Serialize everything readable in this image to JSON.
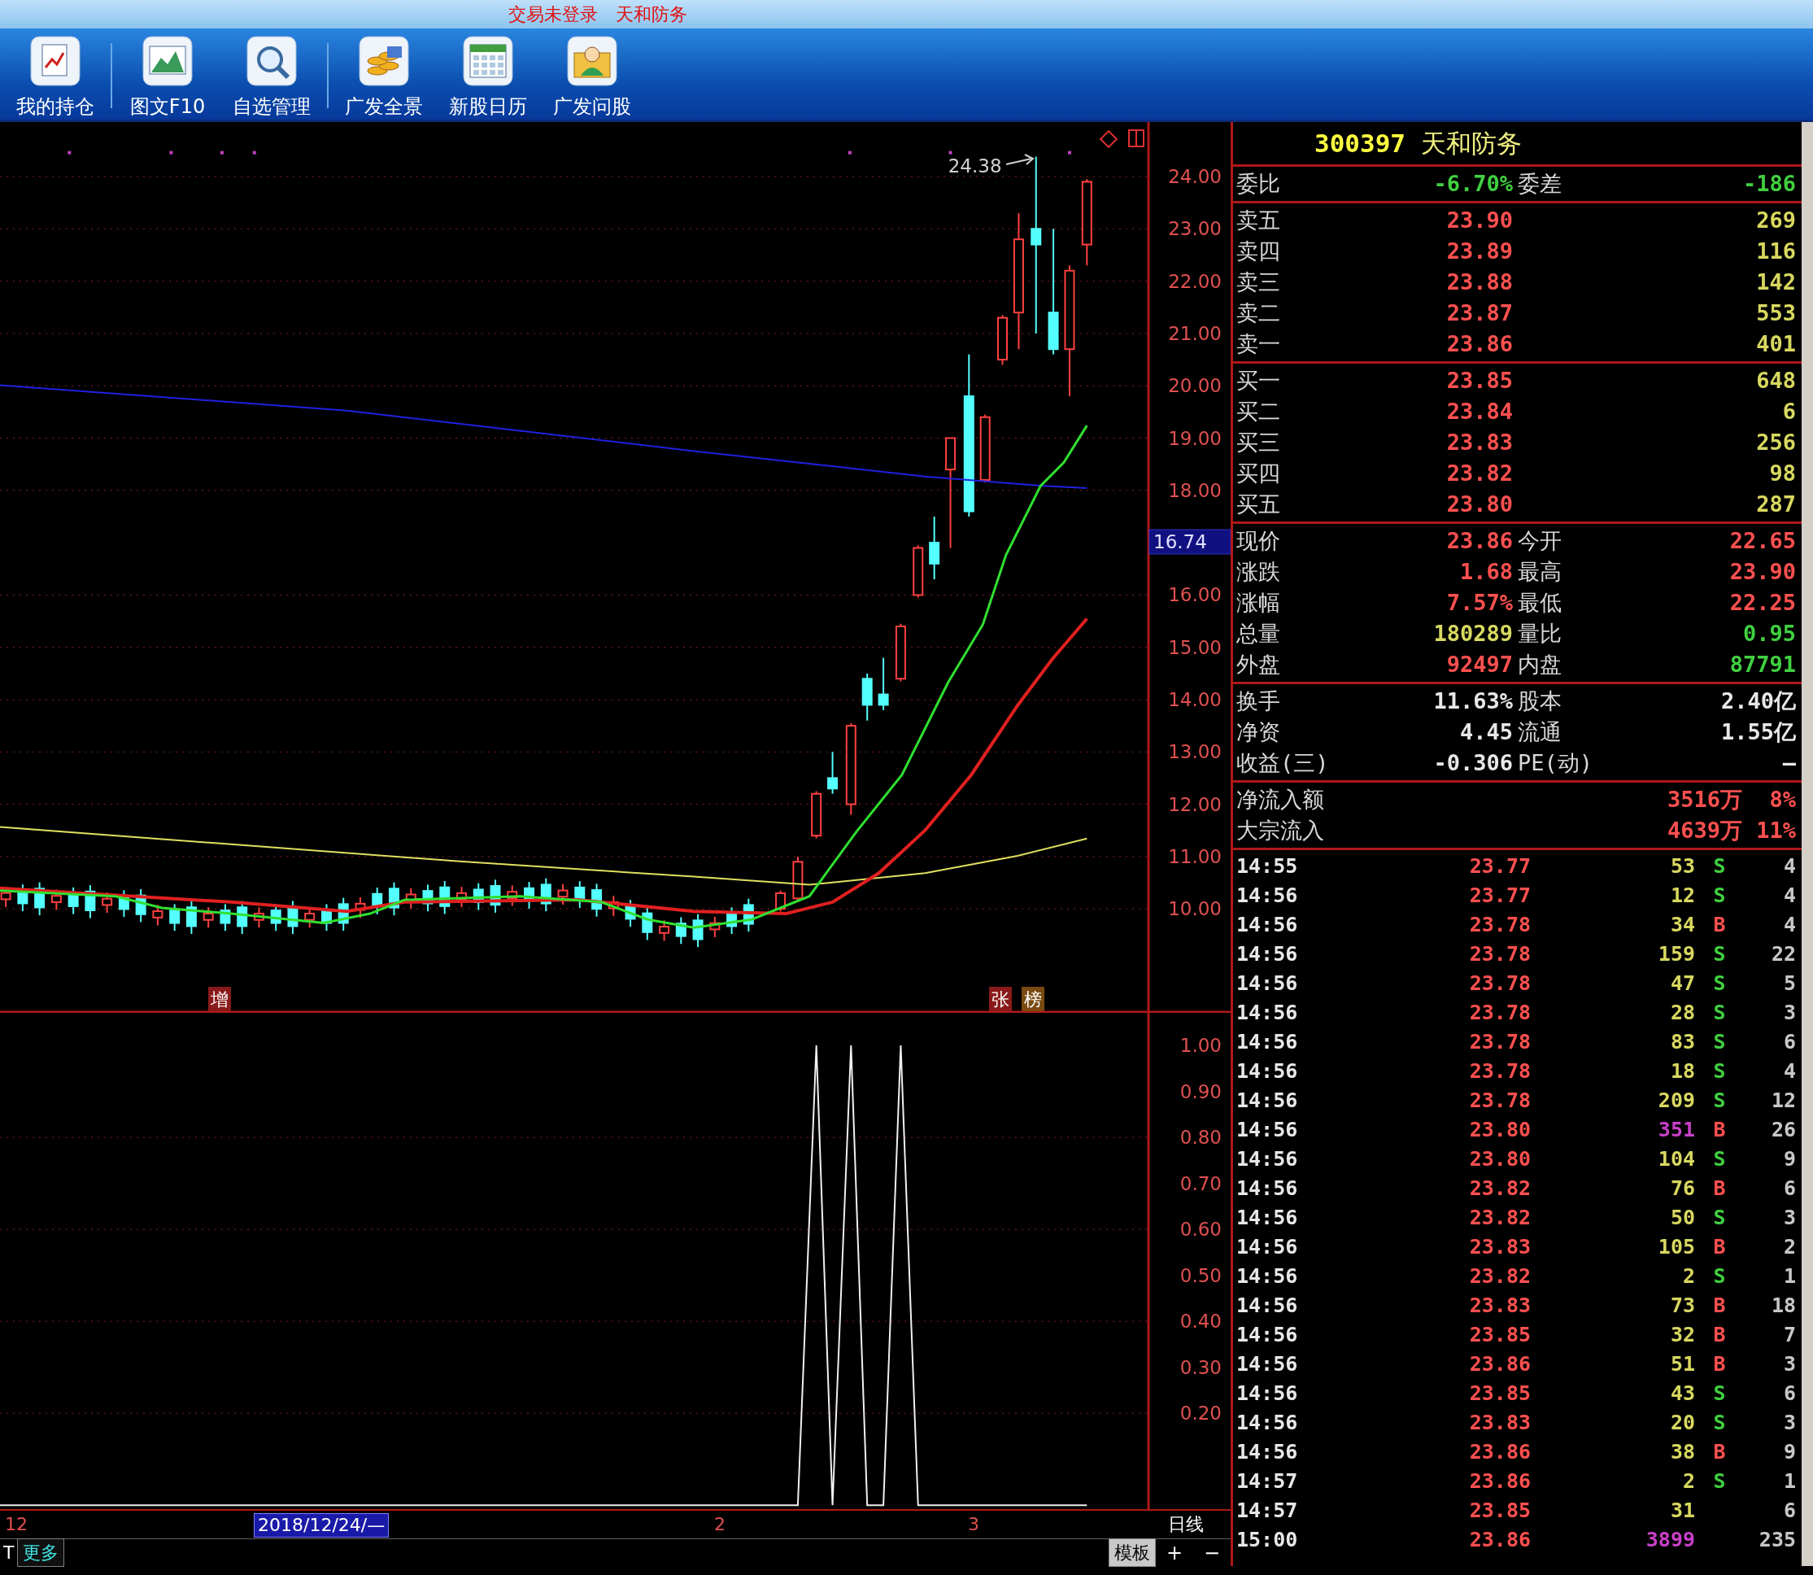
{
  "window": {
    "title": "交易未登录　天和防务"
  },
  "toolbar": [
    {
      "label": "我的持仓",
      "separator_after": true
    },
    {
      "label": "图文F10",
      "separator_after": false
    },
    {
      "label": "自选管理",
      "separator_after": true
    },
    {
      "label": "广发全景",
      "separator_after": false
    },
    {
      "label": "新股日历",
      "separator_after": false
    },
    {
      "label": "广发问股",
      "separator_after": false
    }
  ],
  "chart": {
    "price_axis": [
      "24.00",
      "23.00",
      "22.00",
      "21.00",
      "20.00",
      "19.00",
      "18.00",
      "16.00",
      "15.00",
      "14.00",
      "13.00",
      "12.00",
      "11.00",
      "10.00"
    ],
    "current_marker": "16.74",
    "high_annotation": "24.38",
    "badges": [
      "增",
      "张",
      "榜"
    ],
    "indicator_axis": [
      "1.00",
      "0.90",
      "0.80",
      "0.70",
      "0.60",
      "0.50",
      "0.40",
      "0.30",
      "0.20"
    ]
  },
  "date_bar": {
    "labels": [
      {
        "text": "12",
        "selected": false
      },
      {
        "text": "2018/12/24/—",
        "selected": true
      },
      {
        "text": "2",
        "selected": false
      },
      {
        "text": "3",
        "selected": false
      }
    ],
    "period": "日线"
  },
  "bottom_bar": {
    "left": "T",
    "more": "更多",
    "template": "模板",
    "plus": "+",
    "minus": "−"
  },
  "quote": {
    "code": "300397",
    "name": "天和防务",
    "ratio": {
      "left": {
        "label": "委比",
        "value": "-6.70%",
        "color": "#40d040"
      },
      "right": {
        "label": "委差",
        "value": "-186",
        "color": "#40d040"
      }
    },
    "sell": [
      {
        "label": "卖五",
        "price": "23.90",
        "volume": "269"
      },
      {
        "label": "卖四",
        "price": "23.89",
        "volume": "116"
      },
      {
        "label": "卖三",
        "price": "23.88",
        "volume": "142"
      },
      {
        "label": "卖二",
        "price": "23.87",
        "volume": "553"
      },
      {
        "label": "卖一",
        "price": "23.86",
        "volume": "401"
      }
    ],
    "buy": [
      {
        "label": "买一",
        "price": "23.85",
        "volume": "648"
      },
      {
        "label": "买二",
        "price": "23.84",
        "volume": "6"
      },
      {
        "label": "买三",
        "price": "23.83",
        "volume": "256"
      },
      {
        "label": "买四",
        "price": "23.82",
        "volume": "98"
      },
      {
        "label": "买五",
        "price": "23.80",
        "volume": "287"
      }
    ],
    "stats": [
      {
        "left": {
          "label": "现价",
          "value": "23.86",
          "color": "#ff5050"
        },
        "right": {
          "label": "今开",
          "value": "22.65",
          "color": "#ff5050"
        }
      },
      {
        "left": {
          "label": "涨跌",
          "value": "1.68",
          "color": "#ff5050"
        },
        "right": {
          "label": "最高",
          "value": "23.90",
          "color": "#ff5050"
        }
      },
      {
        "left": {
          "label": "涨幅",
          "value": "7.57%",
          "color": "#ff5050"
        },
        "right": {
          "label": "最低",
          "value": "22.25",
          "color": "#ff5050"
        }
      },
      {
        "left": {
          "label": "总量",
          "value": "180289",
          "color": "#d8d860"
        },
        "right": {
          "label": "量比",
          "value": "0.95",
          "color": "#40d040"
        }
      },
      {
        "left": {
          "label": "外盘",
          "value": "92497",
          "color": "#ff5050"
        },
        "right": {
          "label": "内盘",
          "value": "87791",
          "color": "#40d040"
        }
      }
    ],
    "fundamentals": [
      {
        "label": "换手",
        "value": "11.63%",
        "label2": "股本",
        "value2": "2.40亿"
      },
      {
        "label": "净资",
        "value": "4.45",
        "label2": "流通",
        "value2": "1.55亿"
      },
      {
        "label": "收益(三)",
        "value": "-0.306",
        "label2": "PE(动)",
        "value2": "—"
      }
    ],
    "flows": [
      {
        "label": "净流入额",
        "amount": "3516万",
        "percent": "8%"
      },
      {
        "label": "大宗流入",
        "amount": "4639万",
        "percent": "11%"
      }
    ]
  },
  "ticks": [
    {
      "time": "14:55",
      "price": "23.77",
      "volume": "53",
      "large": false,
      "kind": "sell",
      "side": "S",
      "count": "4"
    },
    {
      "time": "14:56",
      "price": "23.77",
      "volume": "12",
      "large": false,
      "kind": "sell",
      "side": "S",
      "count": "4"
    },
    {
      "time": "14:56",
      "price": "23.78",
      "volume": "34",
      "large": false,
      "kind": "buy",
      "side": "B",
      "count": "4"
    },
    {
      "time": "14:56",
      "price": "23.78",
      "volume": "159",
      "large": false,
      "kind": "sell",
      "side": "S",
      "count": "22"
    },
    {
      "time": "14:56",
      "price": "23.78",
      "volume": "47",
      "large": false,
      "kind": "sell",
      "side": "S",
      "count": "5"
    },
    {
      "time": "14:56",
      "price": "23.78",
      "volume": "28",
      "large": false,
      "kind": "sell",
      "side": "S",
      "count": "3"
    },
    {
      "time": "14:56",
      "price": "23.78",
      "volume": "83",
      "large": false,
      "kind": "sell",
      "side": "S",
      "count": "6"
    },
    {
      "time": "14:56",
      "price": "23.78",
      "volume": "18",
      "large": false,
      "kind": "sell",
      "side": "S",
      "count": "4"
    },
    {
      "time": "14:56",
      "price": "23.78",
      "volume": "209",
      "large": false,
      "kind": "sell",
      "side": "S",
      "count": "12"
    },
    {
      "time": "14:56",
      "price": "23.80",
      "volume": "351",
      "large": true,
      "kind": "buy",
      "side": "B",
      "count": "26"
    },
    {
      "time": "14:56",
      "price": "23.80",
      "volume": "104",
      "large": false,
      "kind": "sell",
      "side": "S",
      "count": "9"
    },
    {
      "time": "14:56",
      "price": "23.82",
      "volume": "76",
      "large": false,
      "kind": "buy",
      "side": "B",
      "count": "6"
    },
    {
      "time": "14:56",
      "price": "23.82",
      "volume": "50",
      "large": false,
      "kind": "sell",
      "side": "S",
      "count": "3"
    },
    {
      "time": "14:56",
      "price": "23.83",
      "volume": "105",
      "large": false,
      "kind": "buy",
      "side": "B",
      "count": "2"
    },
    {
      "time": "14:56",
      "price": "23.82",
      "volume": "2",
      "large": false,
      "kind": "sell",
      "side": "S",
      "count": "1"
    },
    {
      "time": "14:56",
      "price": "23.83",
      "volume": "73",
      "large": false,
      "kind": "buy",
      "side": "B",
      "count": "18"
    },
    {
      "time": "14:56",
      "price": "23.85",
      "volume": "32",
      "large": false,
      "kind": "buy",
      "side": "B",
      "count": "7"
    },
    {
      "time": "14:56",
      "price": "23.86",
      "volume": "51",
      "large": false,
      "kind": "buy",
      "side": "B",
      "count": "3"
    },
    {
      "time": "14:56",
      "price": "23.85",
      "volume": "43",
      "large": false,
      "kind": "sell",
      "side": "S",
      "count": "6"
    },
    {
      "time": "14:56",
      "price": "23.83",
      "volume": "20",
      "large": false,
      "kind": "sell",
      "side": "S",
      "count": "3"
    },
    {
      "time": "14:56",
      "price": "23.86",
      "volume": "38",
      "large": false,
      "kind": "buy",
      "side": "B",
      "count": "9"
    },
    {
      "time": "14:57",
      "price": "23.86",
      "volume": "2",
      "large": false,
      "kind": "sell",
      "side": "S",
      "count": "1"
    },
    {
      "time": "14:57",
      "price": "23.85",
      "volume": "31",
      "large": false,
      "kind": "none",
      "count": "6"
    },
    {
      "time": "15:00",
      "price": "23.86",
      "volume": "3899",
      "large": true,
      "kind": "none",
      "count": "235"
    }
  ]
}
